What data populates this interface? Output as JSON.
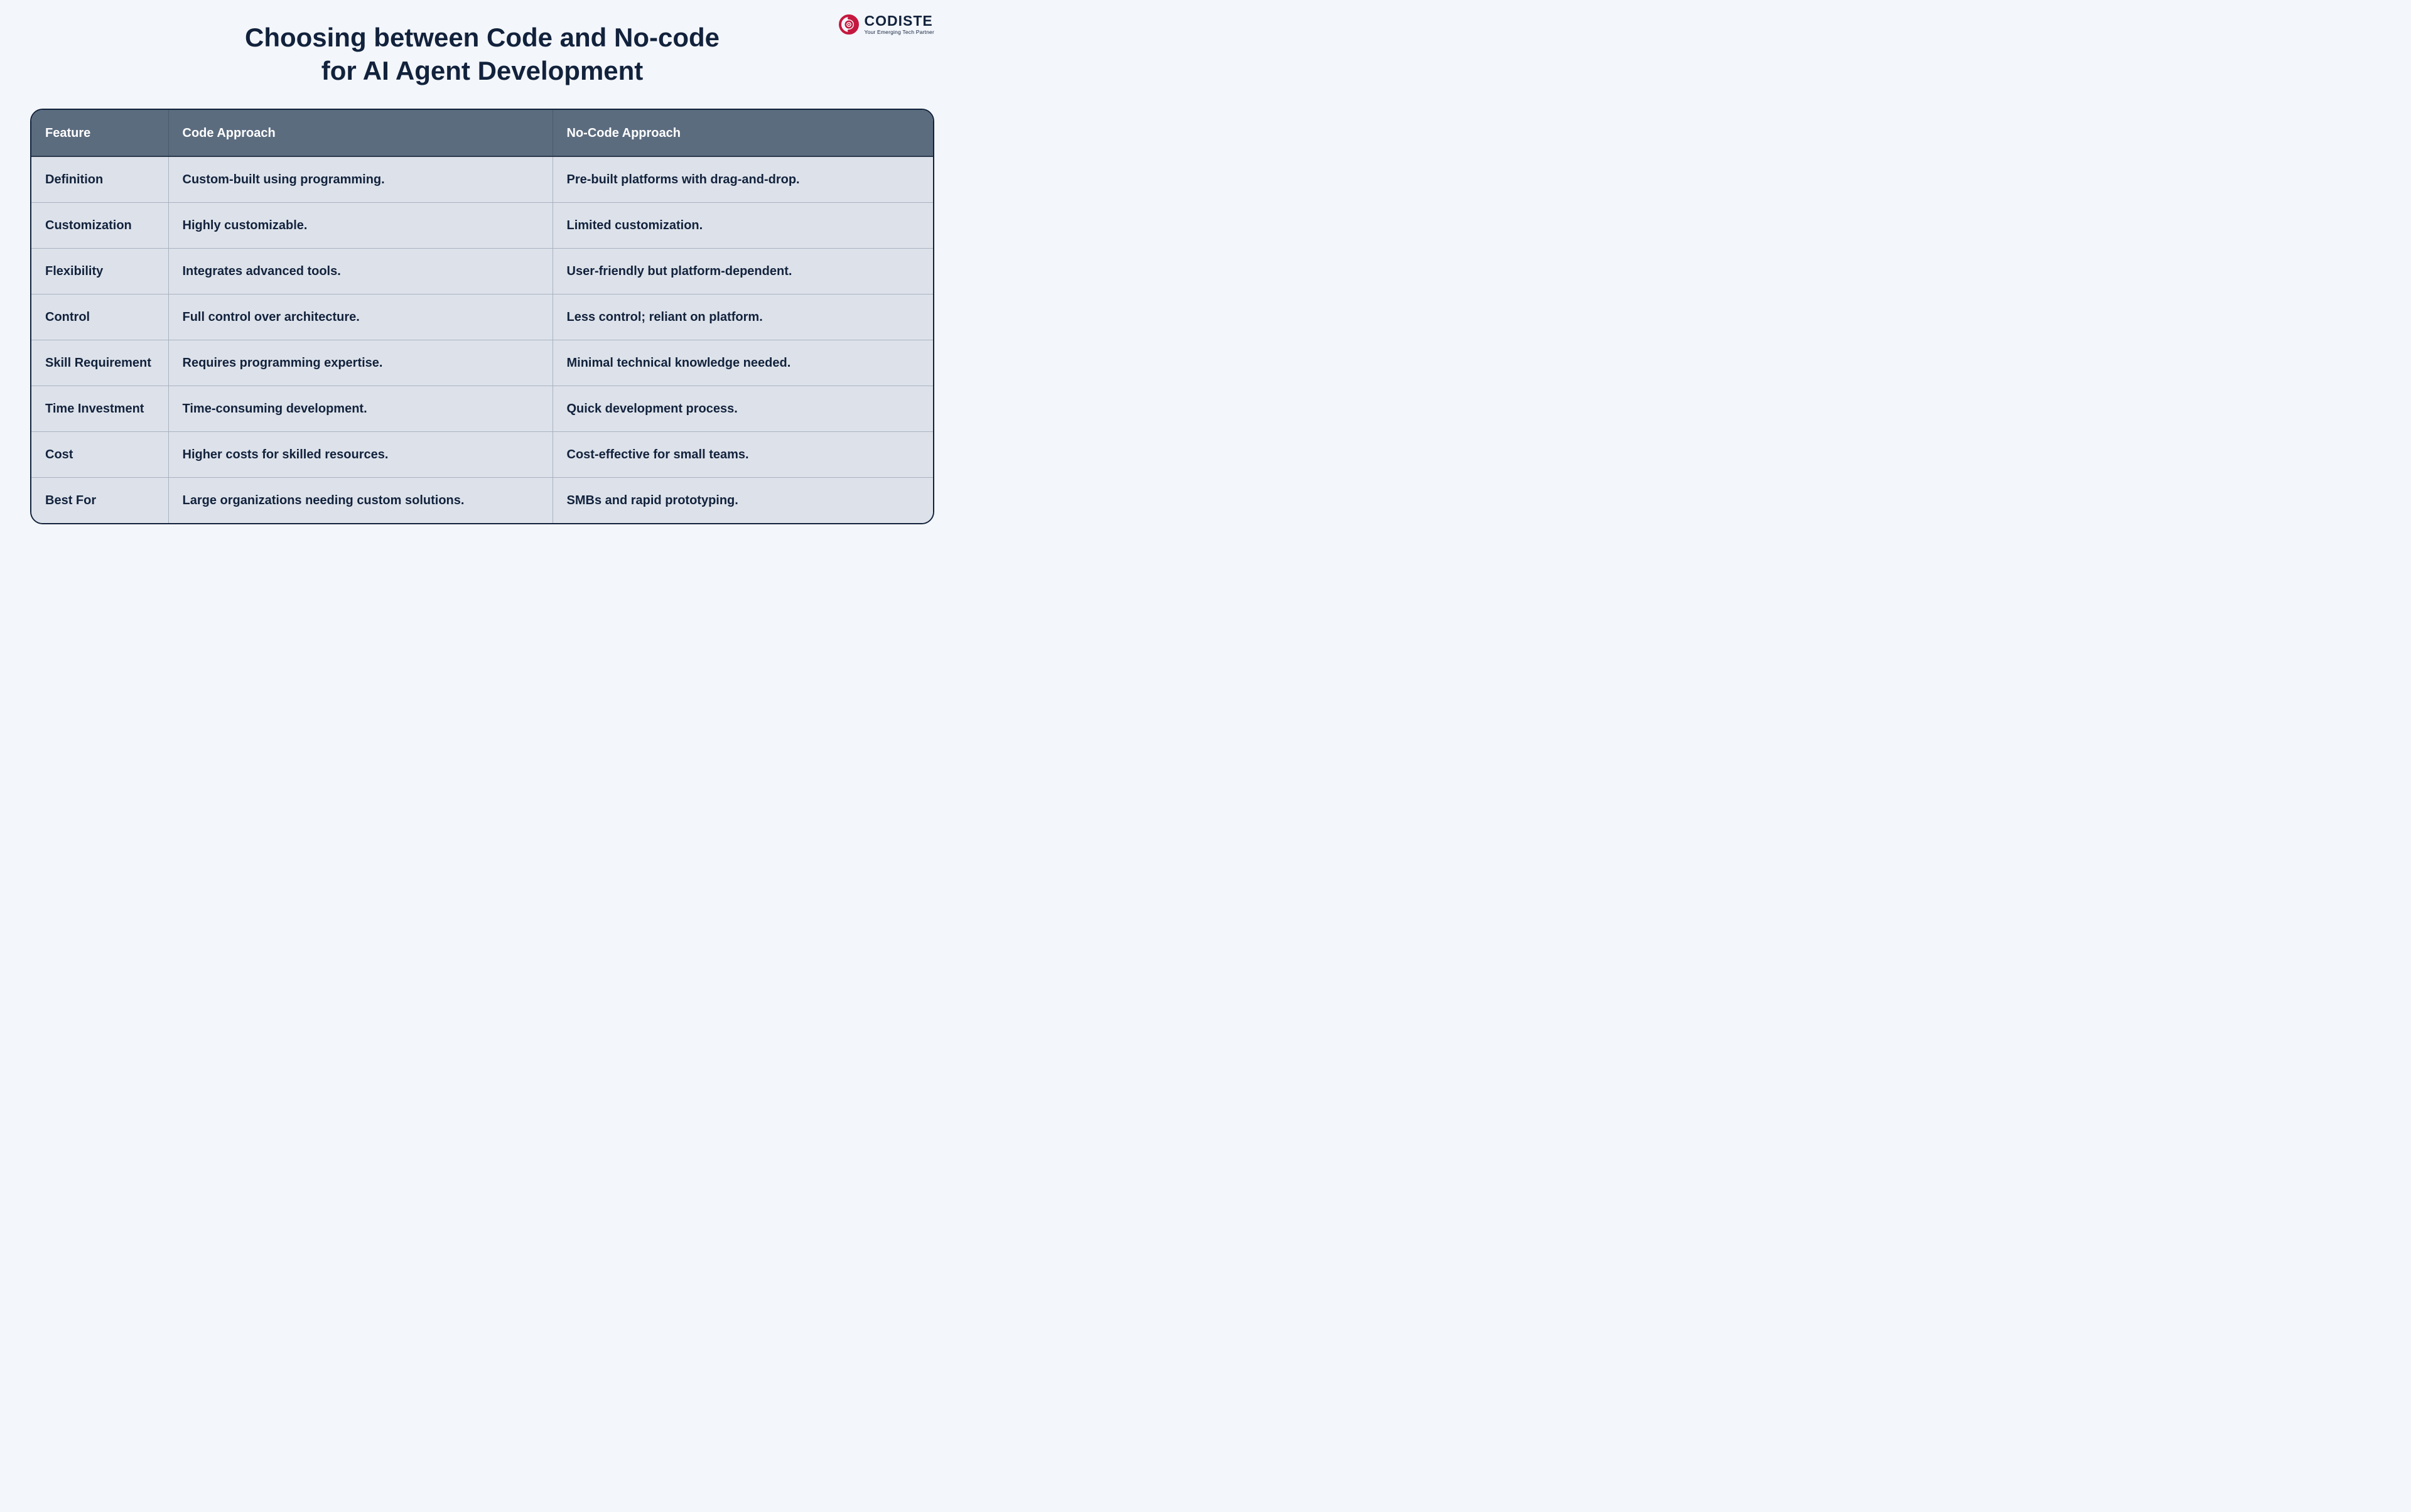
{
  "logo": {
    "name": "CODISTE",
    "tagline": "Your Emerging Tech Partner"
  },
  "title_line1": "Choosing between Code and No-code",
  "title_line2": "for AI Agent Development",
  "table": {
    "headers": {
      "feature": "Feature",
      "code": "Code Approach",
      "nocode": "No-Code Approach"
    },
    "rows": [
      {
        "feature": "Definition",
        "code": "Custom-built using programming.",
        "nocode": "Pre-built platforms with drag-and-drop."
      },
      {
        "feature": "Customization",
        "code": "Highly customizable.",
        "nocode": "Limited customization."
      },
      {
        "feature": "Flexibility",
        "code": "Integrates advanced tools.",
        "nocode": "User-friendly but platform-dependent."
      },
      {
        "feature": "Control",
        "code": "Full control over architecture.",
        "nocode": "Less control; reliant on platform."
      },
      {
        "feature": "Skill Requirement",
        "code": "Requires programming expertise.",
        "nocode": "Minimal technical knowledge needed."
      },
      {
        "feature": "Time Investment",
        "code": "Time-consuming development.",
        "nocode": "Quick development process."
      },
      {
        "feature": "Cost",
        "code": "Higher costs for skilled resources.",
        "nocode": "Cost-effective for small teams."
      },
      {
        "feature": "Best For",
        "code": "Large organizations needing custom solutions.",
        "nocode": "SMBs and rapid prototyping."
      }
    ]
  }
}
